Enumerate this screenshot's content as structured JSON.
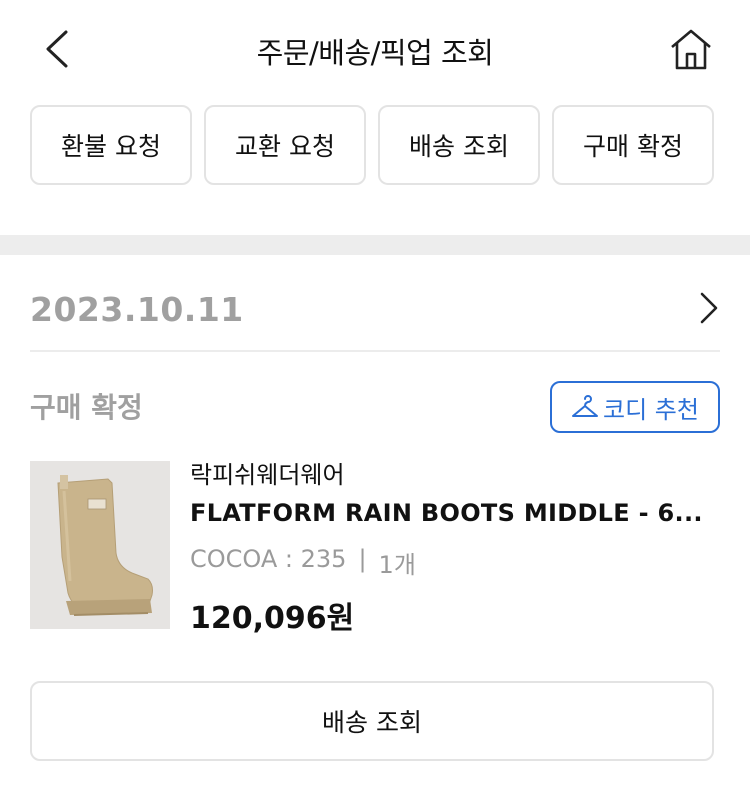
{
  "header": {
    "title": "주문/배송/픽업 조회",
    "back_icon": "chevron-left-icon",
    "home_icon": "home-icon"
  },
  "actions": [
    {
      "label": "환불 요청"
    },
    {
      "label": "교환 요청"
    },
    {
      "label": "배송 조회"
    },
    {
      "label": "구매 확정"
    }
  ],
  "order": {
    "date": "2023.10.11",
    "status": "구매 확정",
    "codi_button": {
      "label": "코디 추천",
      "icon": "hanger-icon",
      "color": "#2b6fd6"
    },
    "product": {
      "brand": "락피쉬웨더웨어",
      "name": "FLATFORM RAIN BOOTS MIDDLE - 6...",
      "option": "COCOA : 235",
      "quantity": "1개",
      "price": "120,096원"
    },
    "shipping_button": {
      "label": "배송 조회"
    }
  },
  "colors": {
    "accent": "#2b6fd6",
    "muted_text": "#a0a0a0",
    "border": "#e3e3e3",
    "section_band": "#ededed"
  }
}
